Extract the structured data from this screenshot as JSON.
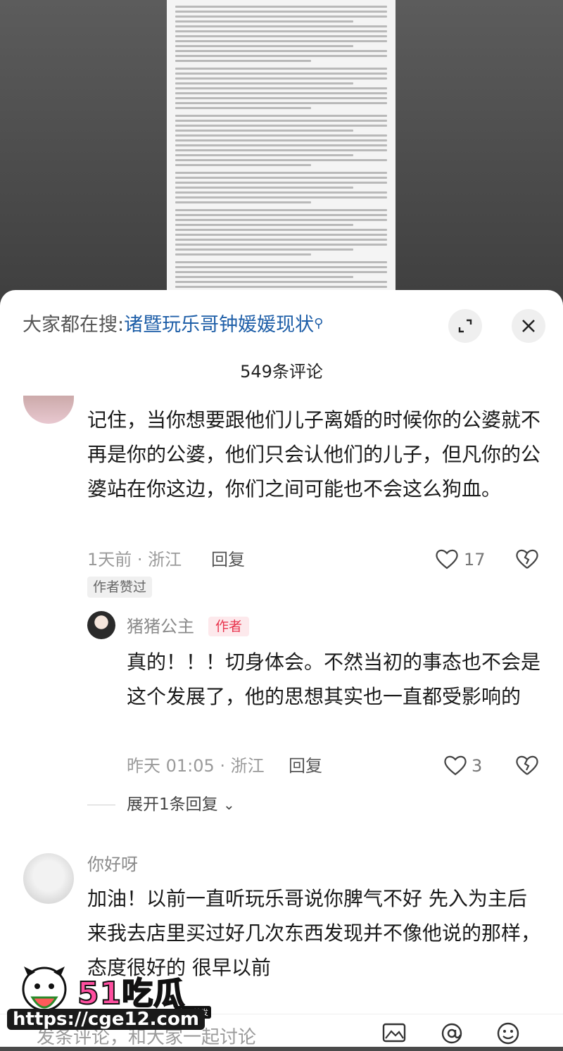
{
  "search": {
    "prefix": "大家都在搜:",
    "query": "诸暨玩乐哥钟媛媛现状"
  },
  "comments_count": "549条评论",
  "comments": [
    {
      "text": "记住，当你想要跟他们儿子离婚的时候你的公婆就不再是你的公婆，他们只会认他们的儿子，但凡你的公婆站在你这边，你们之间可能也不会这么狗血。",
      "meta": "1天前 · 浙江",
      "reply_label": "回复",
      "likes": "17",
      "badge": "作者赞过"
    },
    {
      "author": "猪猪公主",
      "author_badge": "作者",
      "text": "真的！！！切身体会。不然当初的事态也不会是这个发展了，他的思想其实也一直都受影响的",
      "meta": "昨天 01:05 · 浙江",
      "reply_label": "回复",
      "likes": "3"
    },
    {
      "expand_label": "展开1条回复"
    },
    {
      "author": "你好呀",
      "text": "加油！以前一直听玩乐哥说你脾气不好 先入为主后来我去店里买过好几次东西发现并不像他说的那样，态度很好的 很早以前"
    }
  ],
  "input_bar": {
    "placeholder": "发条评论，和大家一起讨论"
  },
  "watermark": {
    "brand": "51吃瓜",
    "tag": "全网首发",
    "url": "https://cge12.com"
  },
  "colors": {
    "link": "#1f5fa8",
    "author_badge": "#e8354e",
    "brand": "#ff4fa0"
  }
}
